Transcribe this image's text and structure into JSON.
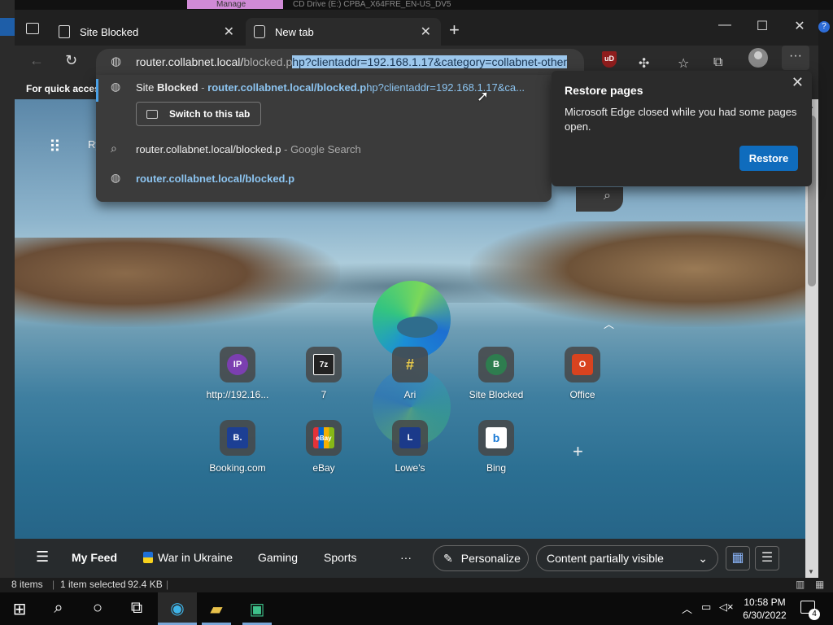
{
  "background": {
    "top_strip_tab": "Manage",
    "top_strip_text": "CD Drive (E:) CPBA_X64FRE_EN-US_DV5"
  },
  "browser": {
    "tabs": [
      {
        "title": "Site Blocked"
      },
      {
        "title": "New tab"
      }
    ],
    "address": {
      "host": "router.collabnet.local/",
      "path_dim": "blocked.p",
      "selected": "hp?clientaddr=192.168.1.17&category=collabnet-other"
    },
    "favorites_bar_text": "For quick access"
  },
  "suggestions": {
    "first": {
      "title_prefix": "Site ",
      "title_bold": "Blocked",
      "separator": " - ",
      "url_bold": "router.collabnet.local/blocked.p",
      "url_rest": "hp?clientaddr=192.168.1.17&ca..."
    },
    "switch_label": "Switch to this tab",
    "second": {
      "query": "router.collabnet.local/blocked.p",
      "suffix": " - Google Search"
    },
    "third": {
      "url": "router.collabnet.local/blocked.p"
    }
  },
  "restore_popup": {
    "title": "Restore pages",
    "message": "Microsoft Edge closed while you had some pages open.",
    "button": "Restore"
  },
  "page": {
    "side_text": "Ry",
    "quick_links": [
      {
        "label": "http://192.16...",
        "badge": "IP",
        "color": "#7b3fb0"
      },
      {
        "label": "7",
        "badge": "7z",
        "color": "#3a3a3a"
      },
      {
        "label": "Ari",
        "badge": "#",
        "color": "#4a4a4a"
      },
      {
        "label": "Site Blocked",
        "badge": "B",
        "color": "#2e7d4f"
      },
      {
        "label": "Office",
        "badge": "O",
        "color": "#d8431f"
      },
      {
        "label": "Booking.com",
        "badge": "B.",
        "color": "#1c3f94"
      },
      {
        "label": "eBay",
        "badge": "eBay",
        "color": "#555555"
      },
      {
        "label": "Lowe's",
        "badge": "L",
        "color": "#1b3a8a"
      },
      {
        "label": "Bing",
        "badge": "b",
        "color": "#ffffff"
      }
    ]
  },
  "feed": {
    "my_feed": "My Feed",
    "war": "War in Ukraine",
    "gaming": "Gaming",
    "sports": "Sports",
    "more": "···",
    "personalize": "Personalize",
    "content": "Content partially visible"
  },
  "statusbar": {
    "items": "8 items",
    "selected": "1 item selected",
    "size": "92.4 KB"
  },
  "taskbar": {
    "time": "10:58 PM",
    "date": "6/30/2022",
    "notifications": "4"
  }
}
